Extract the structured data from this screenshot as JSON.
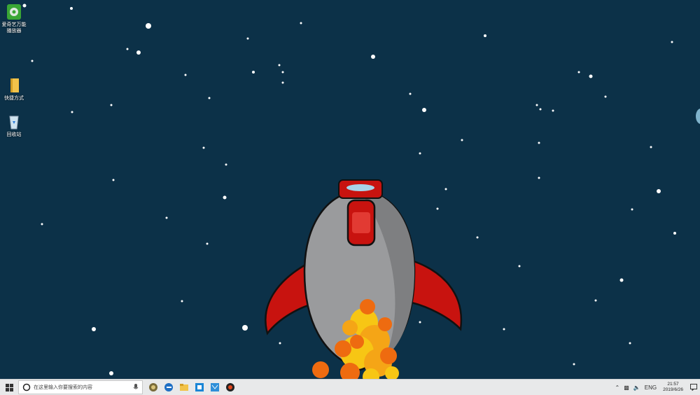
{
  "desktop": {
    "background_color": "#0c3148",
    "icons": [
      {
        "label": "爱奇艺万能播放器",
        "icon": "media-player-icon"
      },
      {
        "label": "快捷方式",
        "icon": "folder-icon"
      },
      {
        "label": "回收站",
        "icon": "recycle-bin-icon"
      }
    ]
  },
  "rocket": {
    "body_color": "#9a9b9d",
    "accent_color": "#c8130f",
    "flame_colors": [
      "#f5a516",
      "#f7c614",
      "#ee6b10"
    ]
  },
  "taskbar": {
    "search_placeholder": "在这里输入你要搜索的内容",
    "pinned": [
      "cortana-icon",
      "edge-icon",
      "file-explorer-icon",
      "store-icon",
      "mail-icon",
      "recorder-icon"
    ],
    "tray": {
      "language": "ENG",
      "time": "21:57",
      "date": "2019/6/26"
    }
  }
}
